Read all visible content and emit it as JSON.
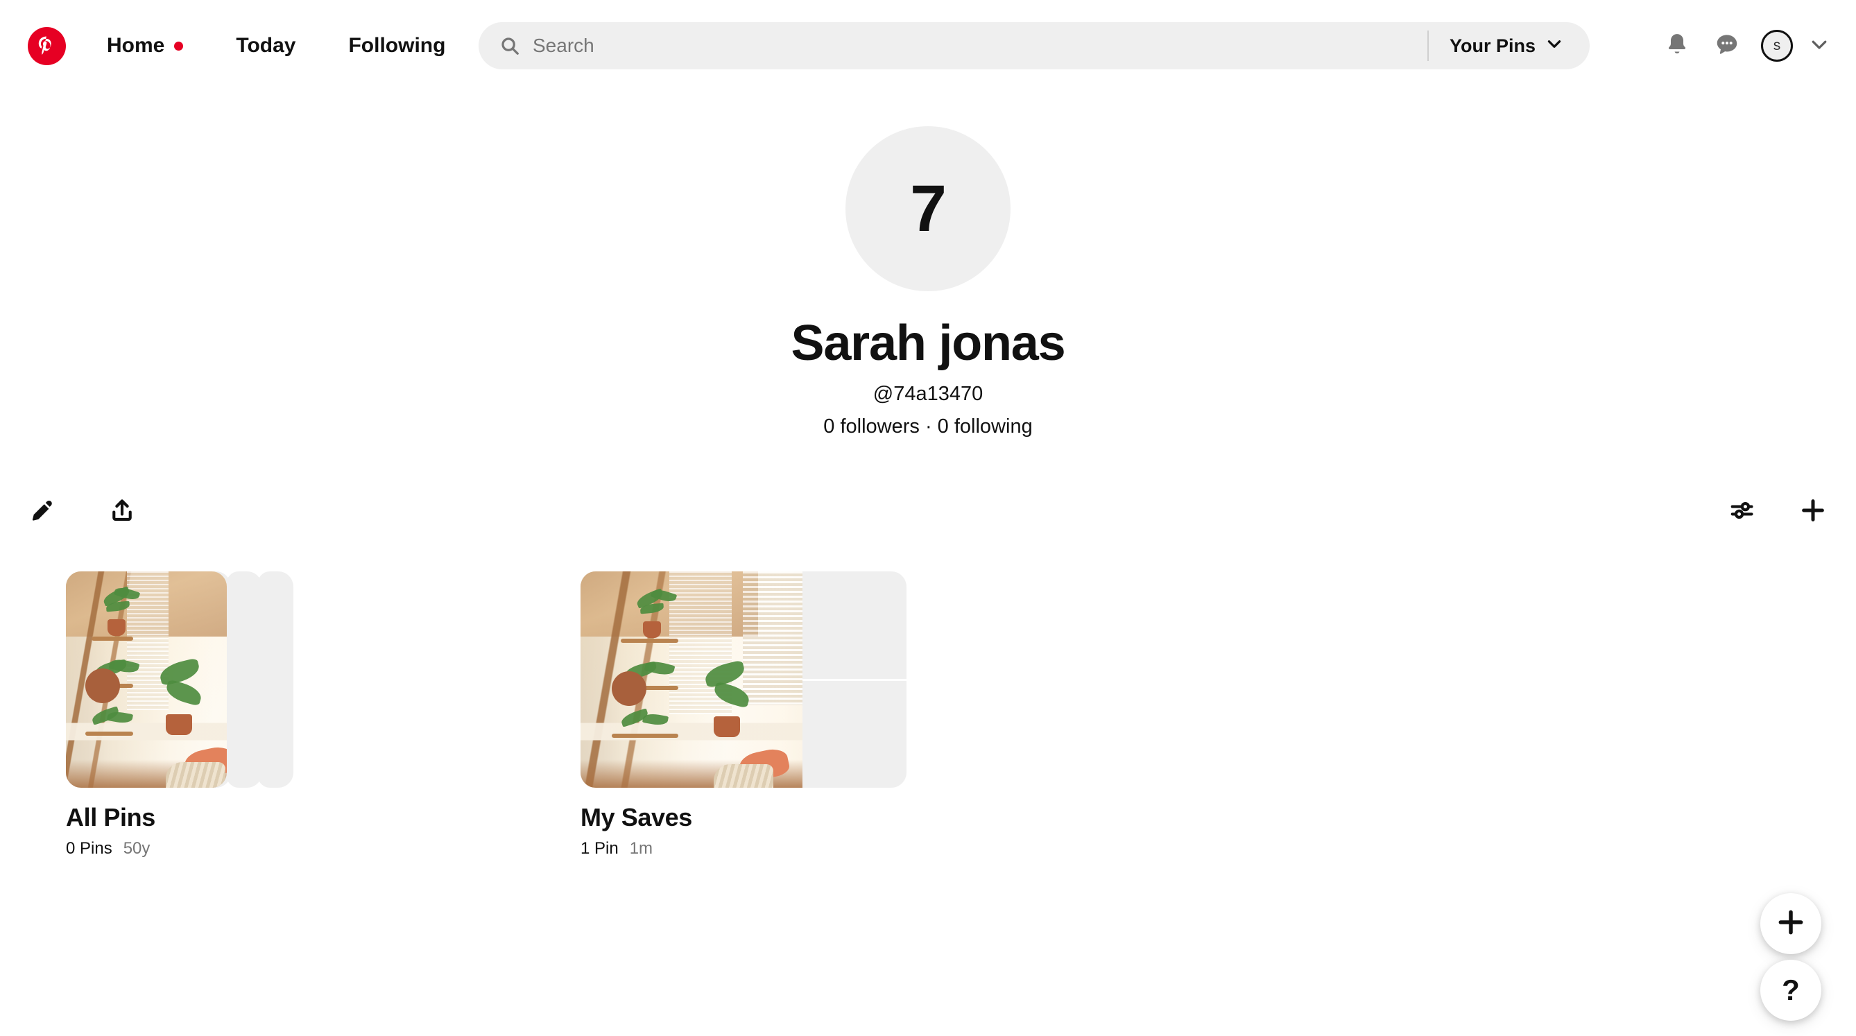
{
  "header": {
    "logo": "pinterest-logo",
    "nav": [
      {
        "label": "Home",
        "has_dot": true,
        "dot_color": "#e60023"
      },
      {
        "label": "Today",
        "has_dot": false
      },
      {
        "label": "Following",
        "has_dot": false
      }
    ],
    "search": {
      "placeholder": "Search",
      "value": "",
      "icon": "search-icon"
    },
    "your_pins": {
      "label": "Your Pins",
      "icon": "chevron-down-icon"
    },
    "icons": {
      "notifications": "bell-icon",
      "messages": "message-bubble-icon",
      "account_chevron": "chevron-down-icon"
    },
    "avatar": {
      "initial": "s"
    }
  },
  "profile": {
    "avatar_text": "7",
    "name": "Sarah jonas",
    "handle": "@74a13470",
    "stats": "0 followers · 0 following"
  },
  "actionbar": {
    "left": [
      {
        "name": "edit-profile-button",
        "icon": "pencil-icon"
      },
      {
        "name": "share-profile-button",
        "icon": "share-upload-icon"
      }
    ],
    "right": [
      {
        "name": "sort-boards-button",
        "icon": "sliders-icon"
      },
      {
        "name": "create-board-button",
        "icon": "plus-icon"
      }
    ]
  },
  "boards": [
    {
      "title": "All Pins",
      "pin_count": "0 Pins",
      "age": "50y",
      "cover_style": "stacked",
      "stack_layers": 3
    },
    {
      "title": "My Saves",
      "pin_count": "1 Pin",
      "age": "1m",
      "cover_style": "grid",
      "stack_layers": 0
    }
  ],
  "floating": {
    "create": {
      "icon": "plus-icon",
      "label": "+"
    },
    "help": {
      "icon": "question-mark-icon",
      "label": "?"
    }
  },
  "colors": {
    "brand_red": "#e60023",
    "surface_gray": "#efefef",
    "text_primary": "#111111",
    "text_secondary": "#767676"
  }
}
